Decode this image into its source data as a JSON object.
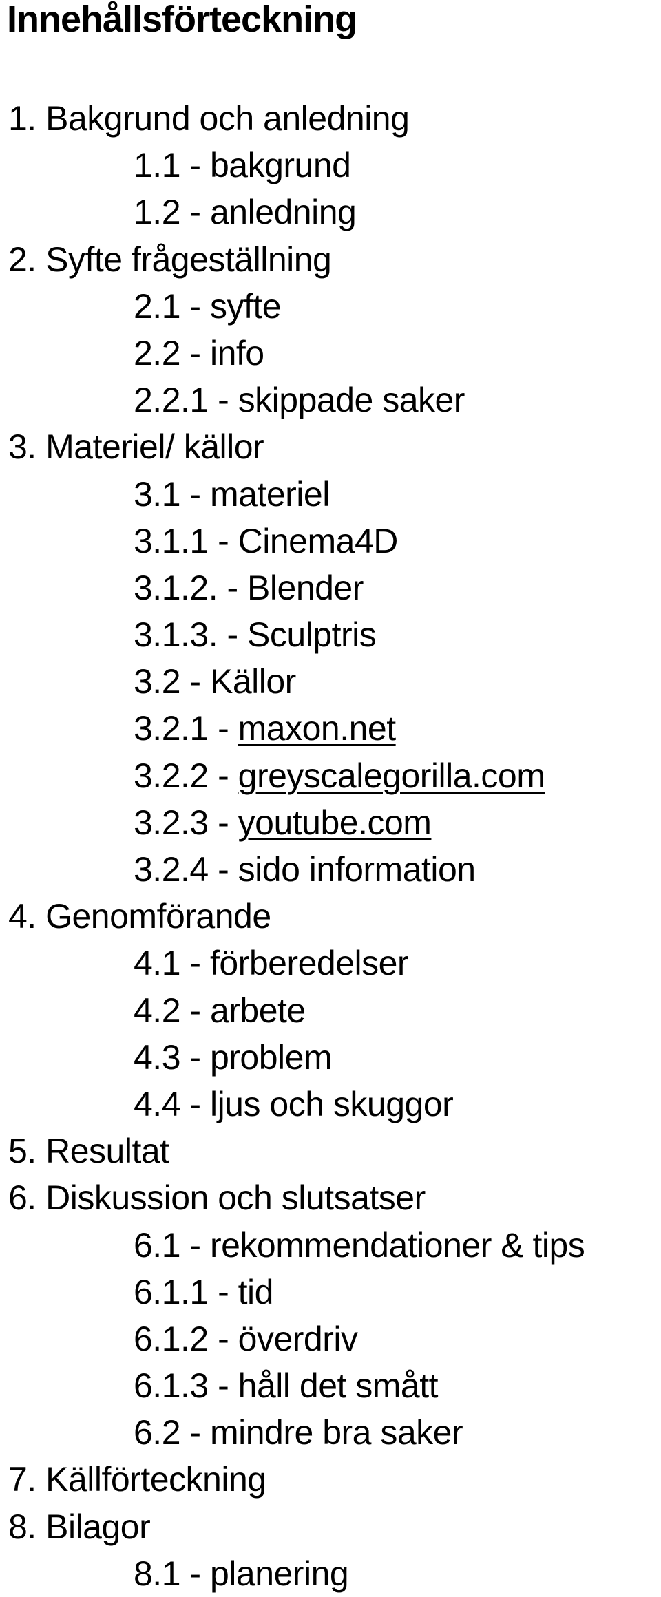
{
  "title": "Innehållsförteckning",
  "items": [
    {
      "level": 1,
      "number": "1.",
      "label": "Bakgrund och anledning"
    },
    {
      "level": 2,
      "number": "1.1 -",
      "label": "bakgrund"
    },
    {
      "level": 2,
      "number": "1.2 -",
      "label": "anledning"
    },
    {
      "level": 1,
      "number": "2.",
      "label": "Syfte frågeställning"
    },
    {
      "level": 2,
      "number": "2.1 -",
      "label": "syfte"
    },
    {
      "level": 2,
      "number": "2.2 -",
      "label": "info"
    },
    {
      "level": 2,
      "number": "2.2.1 -",
      "label": "skippade saker"
    },
    {
      "level": 1,
      "number": "3.",
      "label": "Materiel/ källor"
    },
    {
      "level": 2,
      "number": "3.1 -",
      "label": "materiel"
    },
    {
      "level": 2,
      "number": "3.1.1 -",
      "label": "Cinema4D"
    },
    {
      "level": 2,
      "number": "3.1.2. -",
      "label": "Blender"
    },
    {
      "level": 2,
      "number": "3.1.3. -",
      "label": "Sculptris"
    },
    {
      "level": 2,
      "number": "3.2 -",
      "label": "Källor"
    },
    {
      "level": 2,
      "number": "3.2.1 -",
      "label": "maxon.net",
      "link": true
    },
    {
      "level": 2,
      "number": "3.2.2 -",
      "label": "greyscalegorilla.com",
      "link": true
    },
    {
      "level": 2,
      "number": "3.2.3 -",
      "label": "youtube.com",
      "link": true
    },
    {
      "level": 2,
      "number": "3.2.4 -",
      "label": "sido information"
    },
    {
      "level": 1,
      "number": "4.",
      "label": "Genomförande"
    },
    {
      "level": 2,
      "number": "4.1 -",
      "label": "förberedelser"
    },
    {
      "level": 2,
      "number": "4.2 -",
      "label": "arbete"
    },
    {
      "level": 2,
      "number": "4.3 -",
      "label": "problem"
    },
    {
      "level": 2,
      "number": "4.4 -",
      "label": "ljus och skuggor"
    },
    {
      "level": 1,
      "number": "5.",
      "label": "Resultat"
    },
    {
      "level": 1,
      "number": "6.",
      "label": "Diskussion och slutsatser"
    },
    {
      "level": 2,
      "number": "6.1 -",
      "label": "rekommendationer & tips"
    },
    {
      "level": 2,
      "number": "6.1.1 -",
      "label": "tid"
    },
    {
      "level": 2,
      "number": "6.1.2 -",
      "label": "överdriv"
    },
    {
      "level": 2,
      "number": "6.1.3 -",
      "label": "håll det smått"
    },
    {
      "level": 2,
      "number": "6.2 -",
      "label": "mindre bra saker"
    },
    {
      "level": 1,
      "number": "7.",
      "label": "Källförteckning"
    },
    {
      "level": 1,
      "number": "8.",
      "label": "Bilagor"
    },
    {
      "level": 2,
      "number": "8.1 -",
      "label": "planering"
    }
  ]
}
